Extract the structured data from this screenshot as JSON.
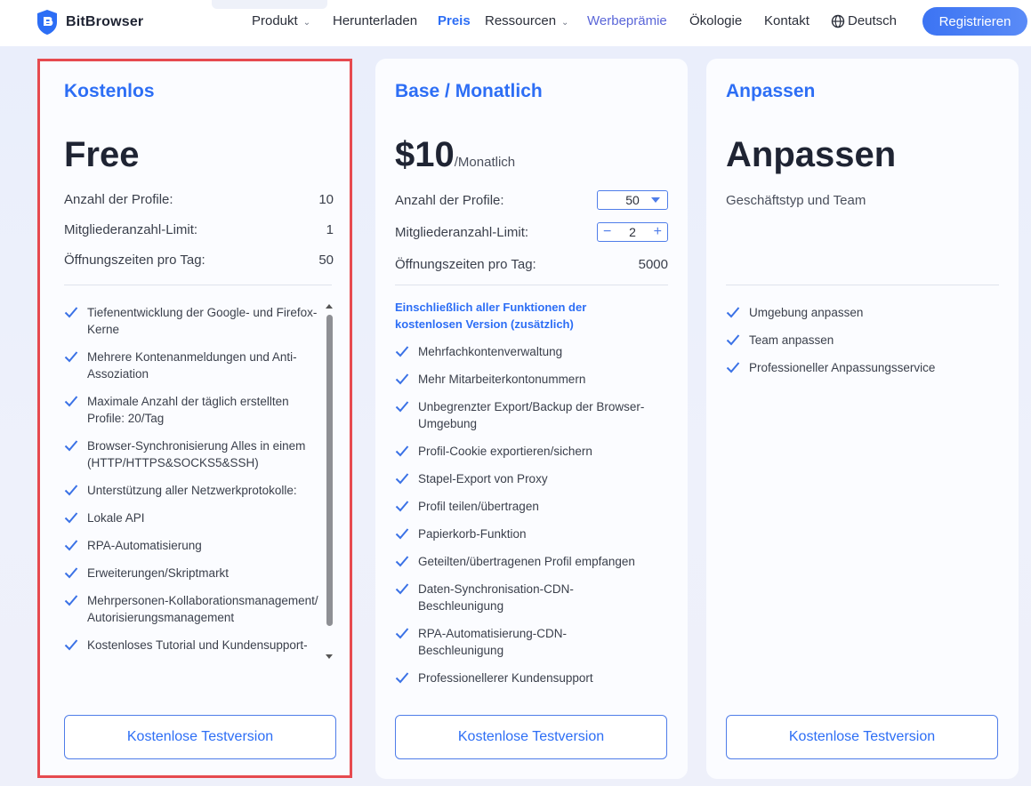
{
  "nav": {
    "brand": "BitBrowser",
    "items": [
      {
        "label": "Produkt",
        "dropdown": true
      },
      {
        "label": "Herunterladen"
      },
      {
        "label": "Preis",
        "active": true
      },
      {
        "label": "Ressourcen",
        "dropdown": true
      },
      {
        "label": "Werbeprämie",
        "highlight": true
      },
      {
        "label": "Ökologie"
      },
      {
        "label": "Kontakt"
      }
    ],
    "language": "Deutsch",
    "register": "Registrieren"
  },
  "plans": [
    {
      "name": "Kostenlos",
      "price": "Free",
      "specs": [
        {
          "label": "Anzahl der Profile:",
          "value": "10"
        },
        {
          "label": "Mitgliederanzahl-Limit:",
          "value": "1"
        },
        {
          "label": "Öffnungszeiten pro Tag:",
          "value": "50"
        }
      ],
      "features": [
        "Tiefenentwicklung der Google- und Firefox-Kerne",
        "Mehrere Kontenanmeldungen und Anti-Assoziation",
        "Maximale Anzahl der täglich erstellten Profile: 20/Tag",
        "Browser-Synchronisierung Alles in einem (HTTP/HTTPS&SOCKS5&SSH)",
        "Unterstützung aller Netzwerkprotokolle:",
        "Lokale API",
        "RPA-Automatisierung",
        "Erweiterungen/Skriptmarkt",
        "Mehrpersonen-Kollaborationsmanagement/ Autorisierungsmanagement",
        "Kostenloses Tutorial und Kundensupport-"
      ],
      "cta": "Kostenlose Testversion"
    },
    {
      "name": "Base / Monatlich",
      "price": "$10",
      "price_unit": "/Monatlich",
      "specs": [
        {
          "label": "Anzahl der Profile:",
          "value": "50"
        },
        {
          "label": "Mitgliederanzahl-Limit:",
          "value": "2"
        },
        {
          "label": "Öffnungszeiten pro Tag:",
          "value": "5000"
        }
      ],
      "intro": "Einschließlich aller Funktionen der kostenlosen Version (zusätzlich)",
      "features": [
        "Mehrfachkontenverwaltung",
        "Mehr Mitarbeiterkontonummern",
        "Unbegrenzter Export/Backup der Browser-Umgebung",
        "Profil-Cookie exportieren/sichern",
        "Stapel-Export von Proxy",
        "Profil teilen/übertragen",
        "Papierkorb-Funktion",
        "Geteilten/übertragenen Profil empfangen",
        "Daten-Synchronisation-CDN-Beschleunigung",
        "RPA-Automatisierung-CDN-Beschleunigung",
        "Professionellerer Kundensupport"
      ],
      "cta": "Kostenlose Testversion"
    },
    {
      "name": "Anpassen",
      "price": "Anpassen",
      "subtitle": "Geschäftstyp und Team",
      "features": [
        "Umgebung anpassen",
        "Team anpassen",
        "Professioneller Anpassungsservice"
      ],
      "cta": "Kostenlose Testversion"
    }
  ],
  "colors": {
    "accent": "#2d6ef5",
    "highlight_border": "#e64a4f",
    "check": "#3b72e6"
  }
}
